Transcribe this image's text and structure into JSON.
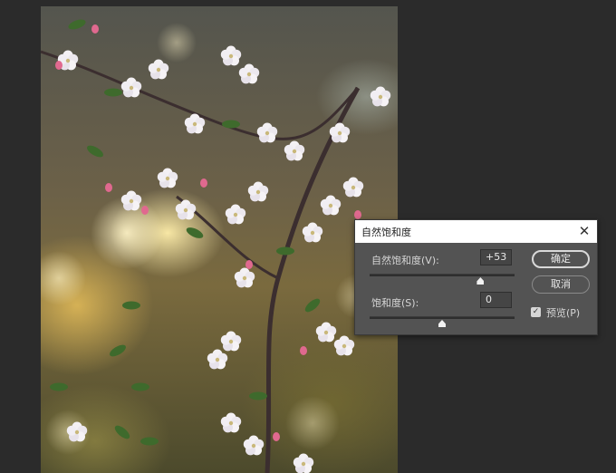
{
  "dialog": {
    "title": "自然饱和度",
    "close_icon": "close-icon",
    "vibrance": {
      "label": "自然饱和度(V):",
      "value": "+53",
      "level": 0.765
    },
    "saturation": {
      "label": "饱和度(S):",
      "value": "0",
      "level": 0.5
    },
    "ok_label": "确定",
    "cancel_label": "取消",
    "preview": {
      "label": "预览(P)",
      "checked": true
    }
  }
}
